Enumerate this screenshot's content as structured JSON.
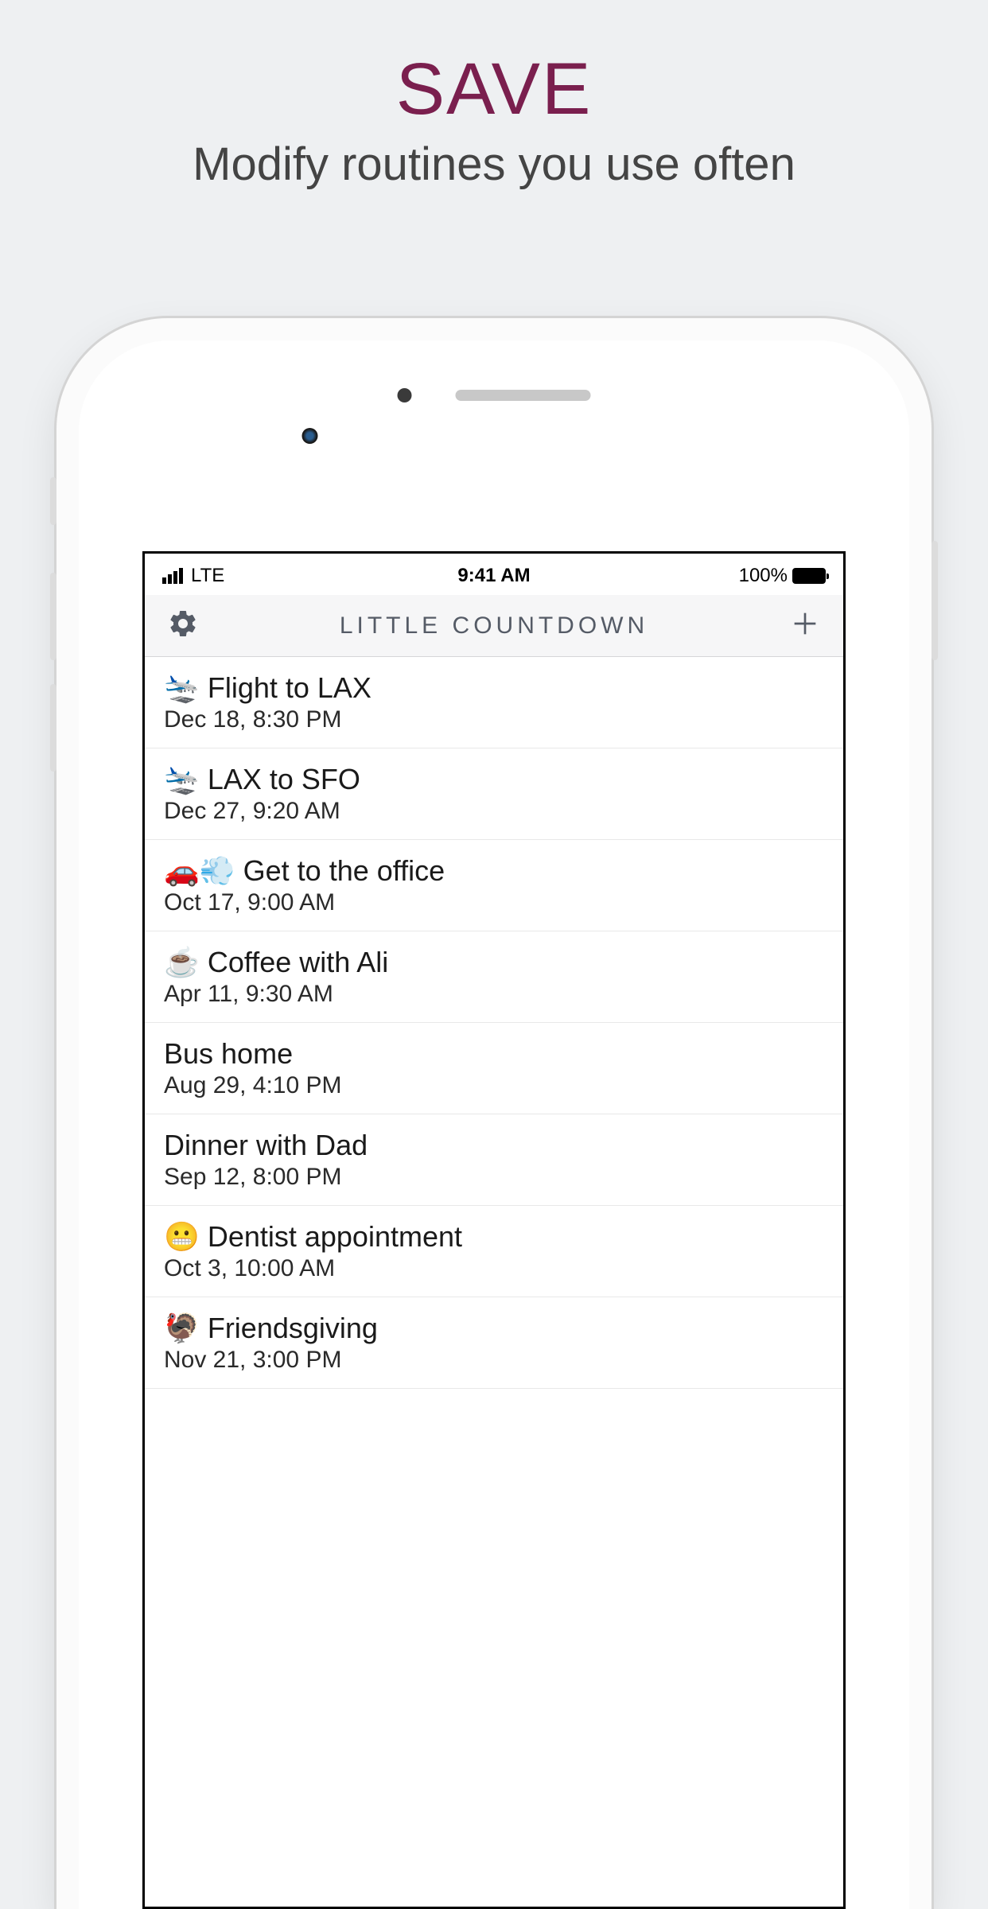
{
  "promo": {
    "title": "SAVE",
    "subtitle": "Modify routines you use often"
  },
  "status_bar": {
    "carrier": "LTE",
    "time": "9:41 AM",
    "battery_text": "100%"
  },
  "nav": {
    "title": "LITTLE COUNTDOWN"
  },
  "events": [
    {
      "title": "🛬 Flight to LAX",
      "date": "Dec 18, 8:30 PM"
    },
    {
      "title": "🛬 LAX to SFO",
      "date": "Dec 27, 9:20 AM"
    },
    {
      "title": "🚗💨 Get to the office",
      "date": "Oct 17, 9:00 AM"
    },
    {
      "title": "☕ Coffee with Ali",
      "date": "Apr 11, 9:30 AM"
    },
    {
      "title": "Bus home",
      "date": "Aug 29, 4:10 PM"
    },
    {
      "title": "Dinner with Dad",
      "date": "Sep 12, 8:00 PM"
    },
    {
      "title": "😬 Dentist appointment",
      "date": "Oct 3, 10:00 AM"
    },
    {
      "title": "🦃 Friendsgiving",
      "date": "Nov 21, 3:00 PM"
    }
  ]
}
